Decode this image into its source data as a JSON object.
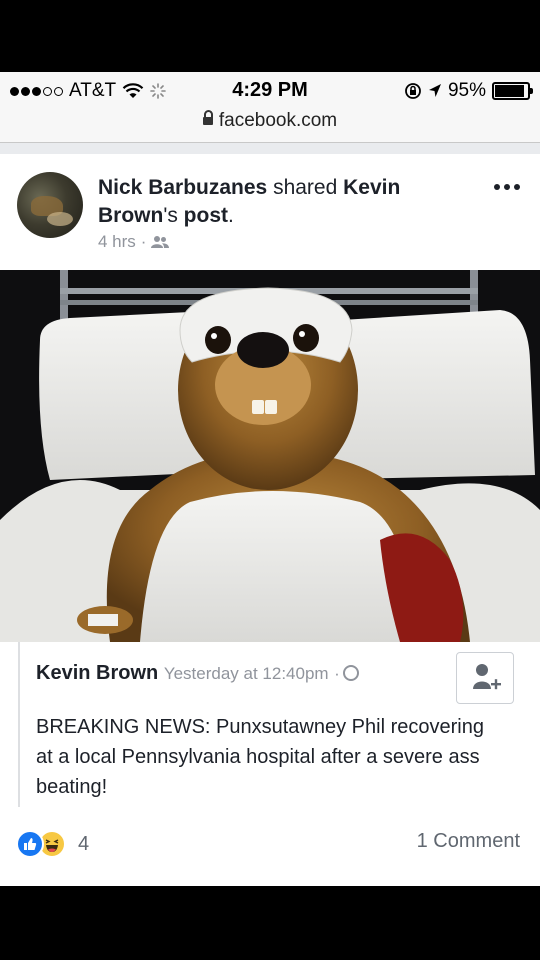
{
  "status_bar": {
    "carrier": "AT&T",
    "time": "4:29 PM",
    "battery": "95%",
    "battery_level": 0.95
  },
  "url_bar": {
    "url": "facebook.com"
  },
  "post": {
    "sharer": "Nick Barbuzanes",
    "shared_text": " shared ",
    "original_author_possessive": "Kevin Brown",
    "possessive_suffix": "'s ",
    "post_word": "post",
    "period": ".",
    "age": "4 hrs",
    "separator": "·",
    "audience_icon": "friends-icon",
    "more_icon": "more-dots-icon"
  },
  "shared_post": {
    "author": "Kevin Brown",
    "timestamp": "Yesterday at 12:40pm",
    "separator": "·",
    "privacy_icon": "globe-icon",
    "add_friend_icon": "add-friend-icon",
    "body": "BREAKING NEWS: Punxsutawney Phil recovering at a local Pennsylvania hospital after a severe ass beating!"
  },
  "engagement": {
    "reaction_icons": [
      "like-icon",
      "haha-icon"
    ],
    "reaction_count": "4",
    "comments": "1 Comment"
  },
  "colors": {
    "link_blue": "#1877f2",
    "meta_gray": "#90949c",
    "text": "#1d2129"
  }
}
